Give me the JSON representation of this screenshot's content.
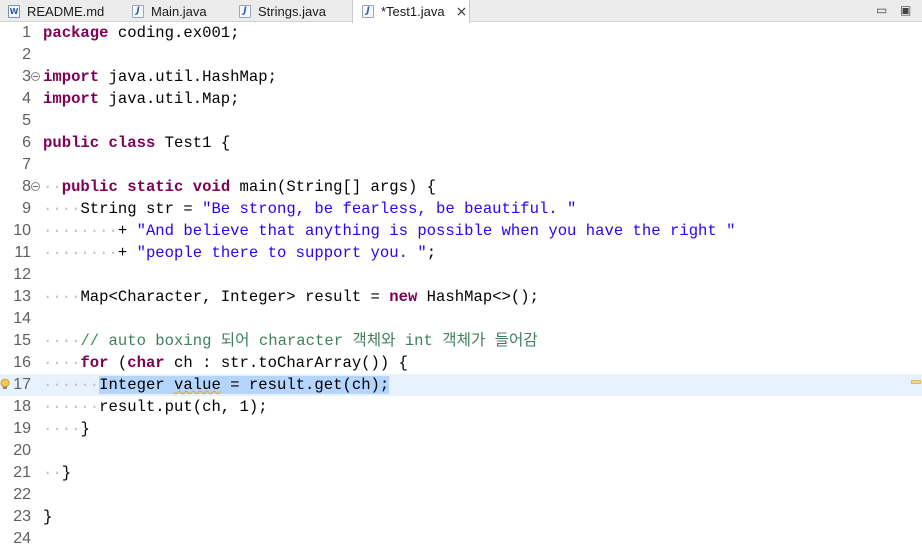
{
  "tabs": [
    {
      "label": "README.md",
      "icon": "markdown-file-icon"
    },
    {
      "label": "Main.java",
      "icon": "java-file-icon"
    },
    {
      "label": "Strings.java",
      "icon": "java-file-icon"
    },
    {
      "label": "*Test1.java",
      "icon": "java-file-icon",
      "active": true,
      "close": "×"
    }
  ],
  "window_controls": {
    "minimize": "▭",
    "maximize": "▣"
  },
  "lines": [
    {
      "n": "1"
    },
    {
      "n": "2"
    },
    {
      "n": "3"
    },
    {
      "n": "4"
    },
    {
      "n": "5"
    },
    {
      "n": "6"
    },
    {
      "n": "7"
    },
    {
      "n": "8"
    },
    {
      "n": "9"
    },
    {
      "n": "10"
    },
    {
      "n": "11"
    },
    {
      "n": "12"
    },
    {
      "n": "13"
    },
    {
      "n": "14"
    },
    {
      "n": "15"
    },
    {
      "n": "16"
    },
    {
      "n": "17"
    },
    {
      "n": "18"
    },
    {
      "n": "19"
    },
    {
      "n": "20"
    },
    {
      "n": "21"
    },
    {
      "n": "22"
    },
    {
      "n": "23"
    },
    {
      "n": "24"
    }
  ],
  "code": {
    "l1_kw": "package",
    "l1_rest": " coding.ex001;",
    "l3_kw": "import",
    "l3_rest": " java.util.HashMap;",
    "l4_kw": "import",
    "l4_rest": " java.util.Map;",
    "l6_kw1": "public",
    "l6_kw2": "class",
    "l6_rest": " Test1 {",
    "l8_kw1": "public",
    "l8_kw2": "static",
    "l8_kw3": "void",
    "l8_rest": " main(String[] args) {",
    "l9_a": "String str = ",
    "l9_str": "\"Be strong, be fearless, be beautiful. \"",
    "l10_a": "+ ",
    "l10_str": "\"And believe that anything is possible when you have the right \"",
    "l11_a": "+ ",
    "l11_str": "\"people there to support you. \"",
    "l11_b": ";",
    "l13_a": "Map<Character, Integer> result = ",
    "l13_kw": "new",
    "l13_b": " HashMap<>();",
    "l15_cm": "// auto boxing 되어 character 객체와 int 객체가 들어감",
    "l16_kw1": "for",
    "l16_a": " (",
    "l16_kw2": "char",
    "l16_b": " ch : str.toCharArray()) {",
    "l17_a": "Integer ",
    "l17_var": "value",
    "l17_b": " = result.get(ch);",
    "l18_a": "result.put(ch, 1);",
    "l19_a": "}",
    "l21_a": "}",
    "l23_a": "}"
  }
}
